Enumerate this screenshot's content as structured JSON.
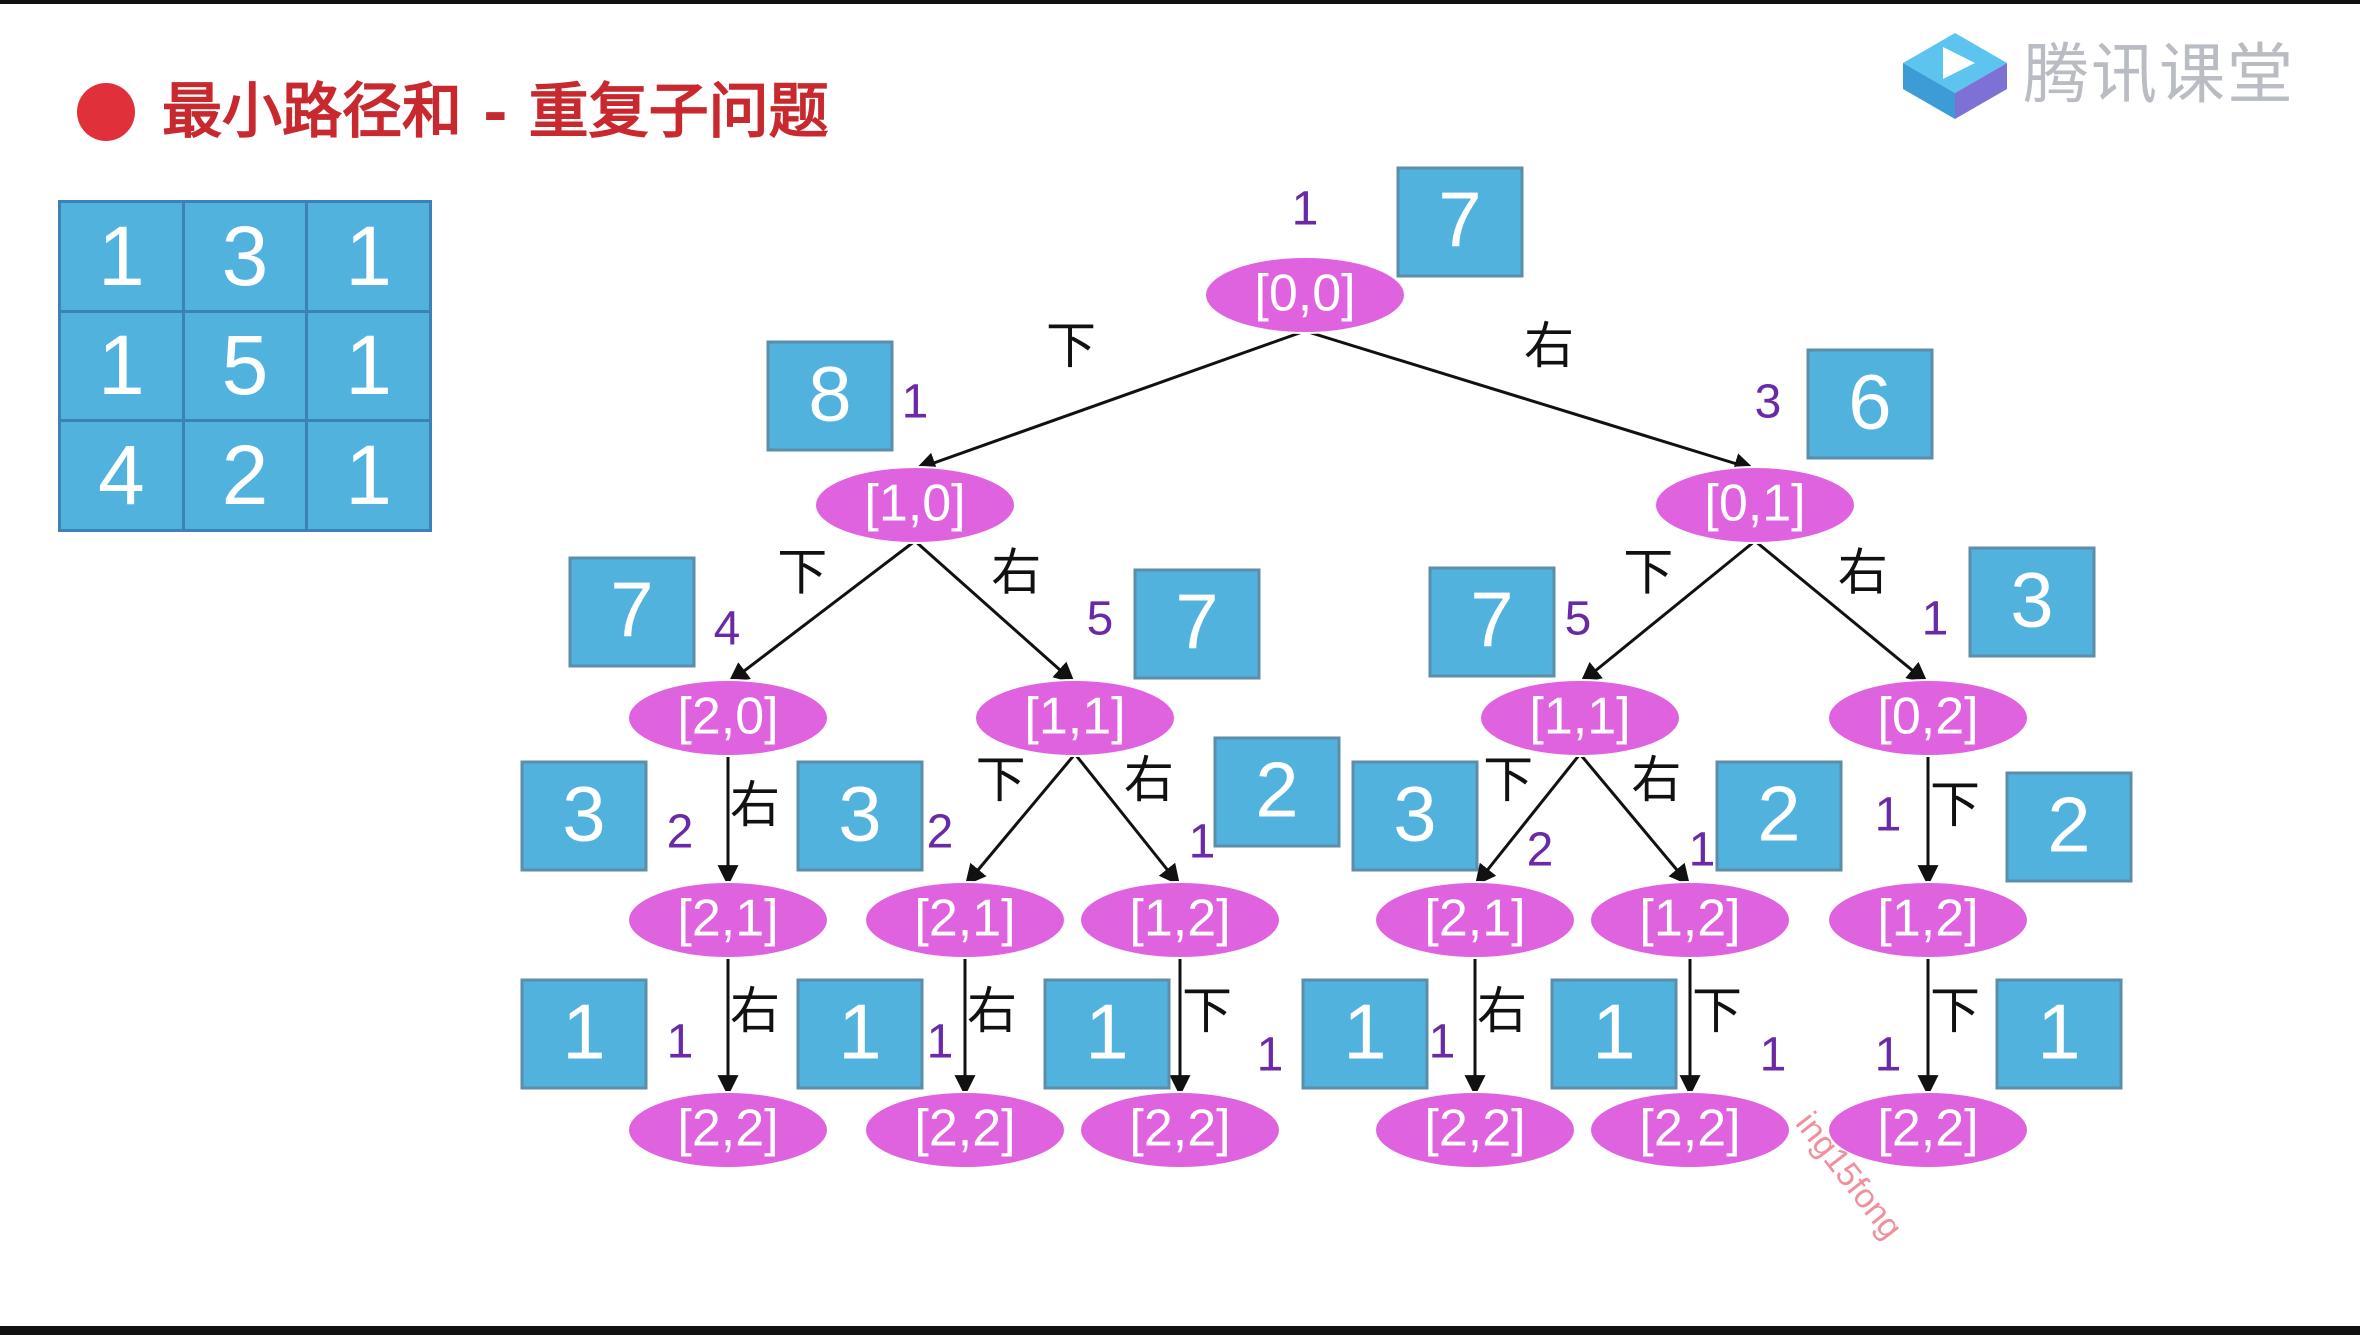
{
  "title": "最小路径和 - 重复子问题",
  "logo": {
    "icon": "play-cube-icon",
    "text": "腾讯课堂"
  },
  "colors": {
    "bullet": "#e0303a",
    "title": "#c8292f",
    "box": "#52b2de",
    "node": "#df62df",
    "count": "#6a2aa6"
  },
  "grid": [
    [
      "1",
      "3",
      "1"
    ],
    [
      "1",
      "5",
      "1"
    ],
    [
      "4",
      "2",
      "1"
    ]
  ],
  "nodes": [
    {
      "id": "n00",
      "label": "[0,0]",
      "count": "1",
      "value": "7"
    },
    {
      "id": "n10",
      "label": "[1,0]",
      "count": "1",
      "value": "8"
    },
    {
      "id": "n01",
      "label": "[0,1]",
      "count": "3",
      "value": "6"
    },
    {
      "id": "n20",
      "label": "[2,0]",
      "count": "4",
      "value": "7"
    },
    {
      "id": "n11a",
      "label": "[1,1]",
      "count": "5",
      "value": "7"
    },
    {
      "id": "n11b",
      "label": "[1,1]",
      "count": "5",
      "value": "7"
    },
    {
      "id": "n02",
      "label": "[0,2]",
      "count": "1",
      "value": "3"
    },
    {
      "id": "n21a",
      "label": "[2,1]",
      "count": "2",
      "value": "3"
    },
    {
      "id": "n21b",
      "label": "[2,1]",
      "count": "2",
      "value": "3"
    },
    {
      "id": "n12a",
      "label": "[1,2]",
      "count": "1",
      "value": "2"
    },
    {
      "id": "n21c",
      "label": "[2,1]",
      "count": "2",
      "value": "3"
    },
    {
      "id": "n12b",
      "label": "[1,2]",
      "count": "1",
      "value": "2"
    },
    {
      "id": "n12c",
      "label": "[1,2]",
      "count": "1",
      "value": "2"
    },
    {
      "id": "n22a",
      "label": "[2,2]",
      "count": "1",
      "value": "1"
    },
    {
      "id": "n22b",
      "label": "[2,2]",
      "count": "1",
      "value": "1"
    },
    {
      "id": "n22c",
      "label": "[2,2]",
      "count": "1",
      "value": "1"
    },
    {
      "id": "n22d",
      "label": "[2,2]",
      "count": "1",
      "value": "1"
    },
    {
      "id": "n22e",
      "label": "[2,2]",
      "count": "1",
      "value": "1"
    },
    {
      "id": "n22f",
      "label": "[2,2]",
      "count": "1",
      "value": "1"
    }
  ],
  "edges": [
    {
      "from": "n00",
      "to": "n10",
      "label": "下"
    },
    {
      "from": "n00",
      "to": "n01",
      "label": "右"
    },
    {
      "from": "n10",
      "to": "n20",
      "label": "下"
    },
    {
      "from": "n10",
      "to": "n11a",
      "label": "右"
    },
    {
      "from": "n01",
      "to": "n11b",
      "label": "下"
    },
    {
      "from": "n01",
      "to": "n02",
      "label": "右"
    },
    {
      "from": "n20",
      "to": "n21a",
      "label": "右"
    },
    {
      "from": "n11a",
      "to": "n21b",
      "label": "下"
    },
    {
      "from": "n11a",
      "to": "n12a",
      "label": "右"
    },
    {
      "from": "n11b",
      "to": "n21c",
      "label": "下"
    },
    {
      "from": "n11b",
      "to": "n12b",
      "label": "右"
    },
    {
      "from": "n02",
      "to": "n12c",
      "label": "下"
    },
    {
      "from": "n21a",
      "to": "n22a",
      "label": "右"
    },
    {
      "from": "n21b",
      "to": "n22b",
      "label": "右"
    },
    {
      "from": "n12a",
      "to": "n22c",
      "label": "下"
    },
    {
      "from": "n21c",
      "to": "n22d",
      "label": "右"
    },
    {
      "from": "n12b",
      "to": "n22e",
      "label": "下"
    },
    {
      "from": "n12c",
      "to": "n22f",
      "label": "下"
    }
  ],
  "watermark": "ing15fong"
}
